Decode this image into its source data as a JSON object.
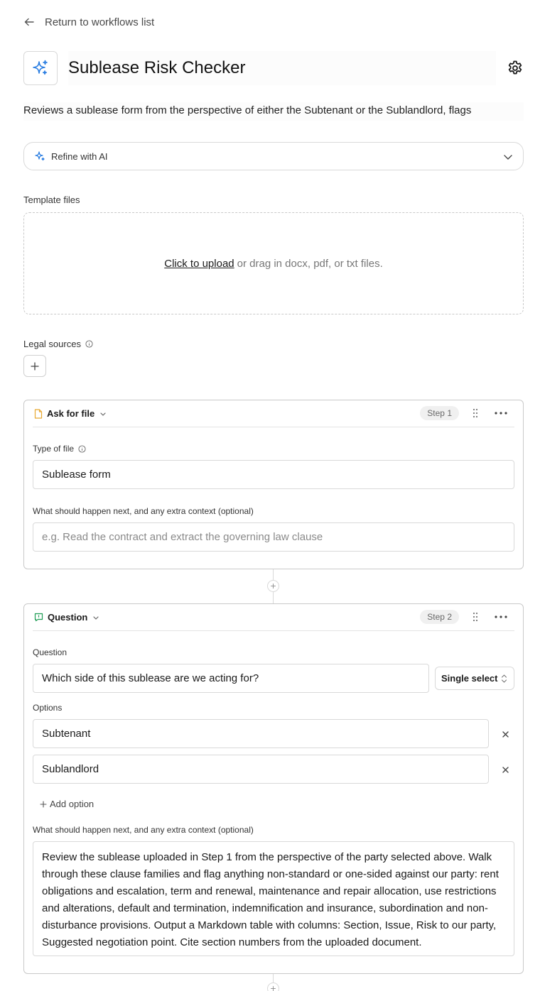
{
  "nav": {
    "back_label": "Return to workflows list"
  },
  "workflow": {
    "title": "Sublease Risk Checker",
    "description": "Reviews a sublease form from the perspective of either the Subtenant or the Sublandlord, flags"
  },
  "refine": {
    "label": "Refine with AI"
  },
  "template_files": {
    "label": "Template files",
    "upload_link": "Click to upload",
    "upload_hint": "or drag in docx, pdf, or txt files."
  },
  "legal_sources": {
    "label": "Legal sources"
  },
  "steps": [
    {
      "type": "Ask for file",
      "badge": "Step 1",
      "file_type_label": "Type of file",
      "file_type_value": "Sublease form",
      "context_label": "What should happen next, and any extra context (optional)",
      "context_placeholder": "e.g. Read the contract and extract the governing law clause"
    },
    {
      "type": "Question",
      "badge": "Step 2",
      "question_label": "Question",
      "question_value": "Which side of this sublease are we acting for?",
      "select_value": "Single select",
      "options_label": "Options",
      "options": [
        "Subtenant",
        "Sublandlord"
      ],
      "add_option_label": "Add option",
      "context_label": "What should happen next, and any extra context (optional)",
      "context_value": "Review the sublease uploaded in Step 1 from the perspective of the party selected above. Walk through these clause families and flag anything non-standard or one-sided against our party: rent obligations and escalation, term and renewal, maintenance and repair allocation, use restrictions and alterations, default and termination, indemnification and insurance, subordination and non-disturbance provisions. Output a Markdown table with columns: Section, Issue, Risk to our party, Suggested negotiation point. Cite section numbers from the uploaded document."
    }
  ],
  "colors": {
    "accent": "#2a7de1",
    "file_icon": "#e8a930",
    "question_icon": "#1f9d55",
    "border": "#d9d9d9"
  }
}
